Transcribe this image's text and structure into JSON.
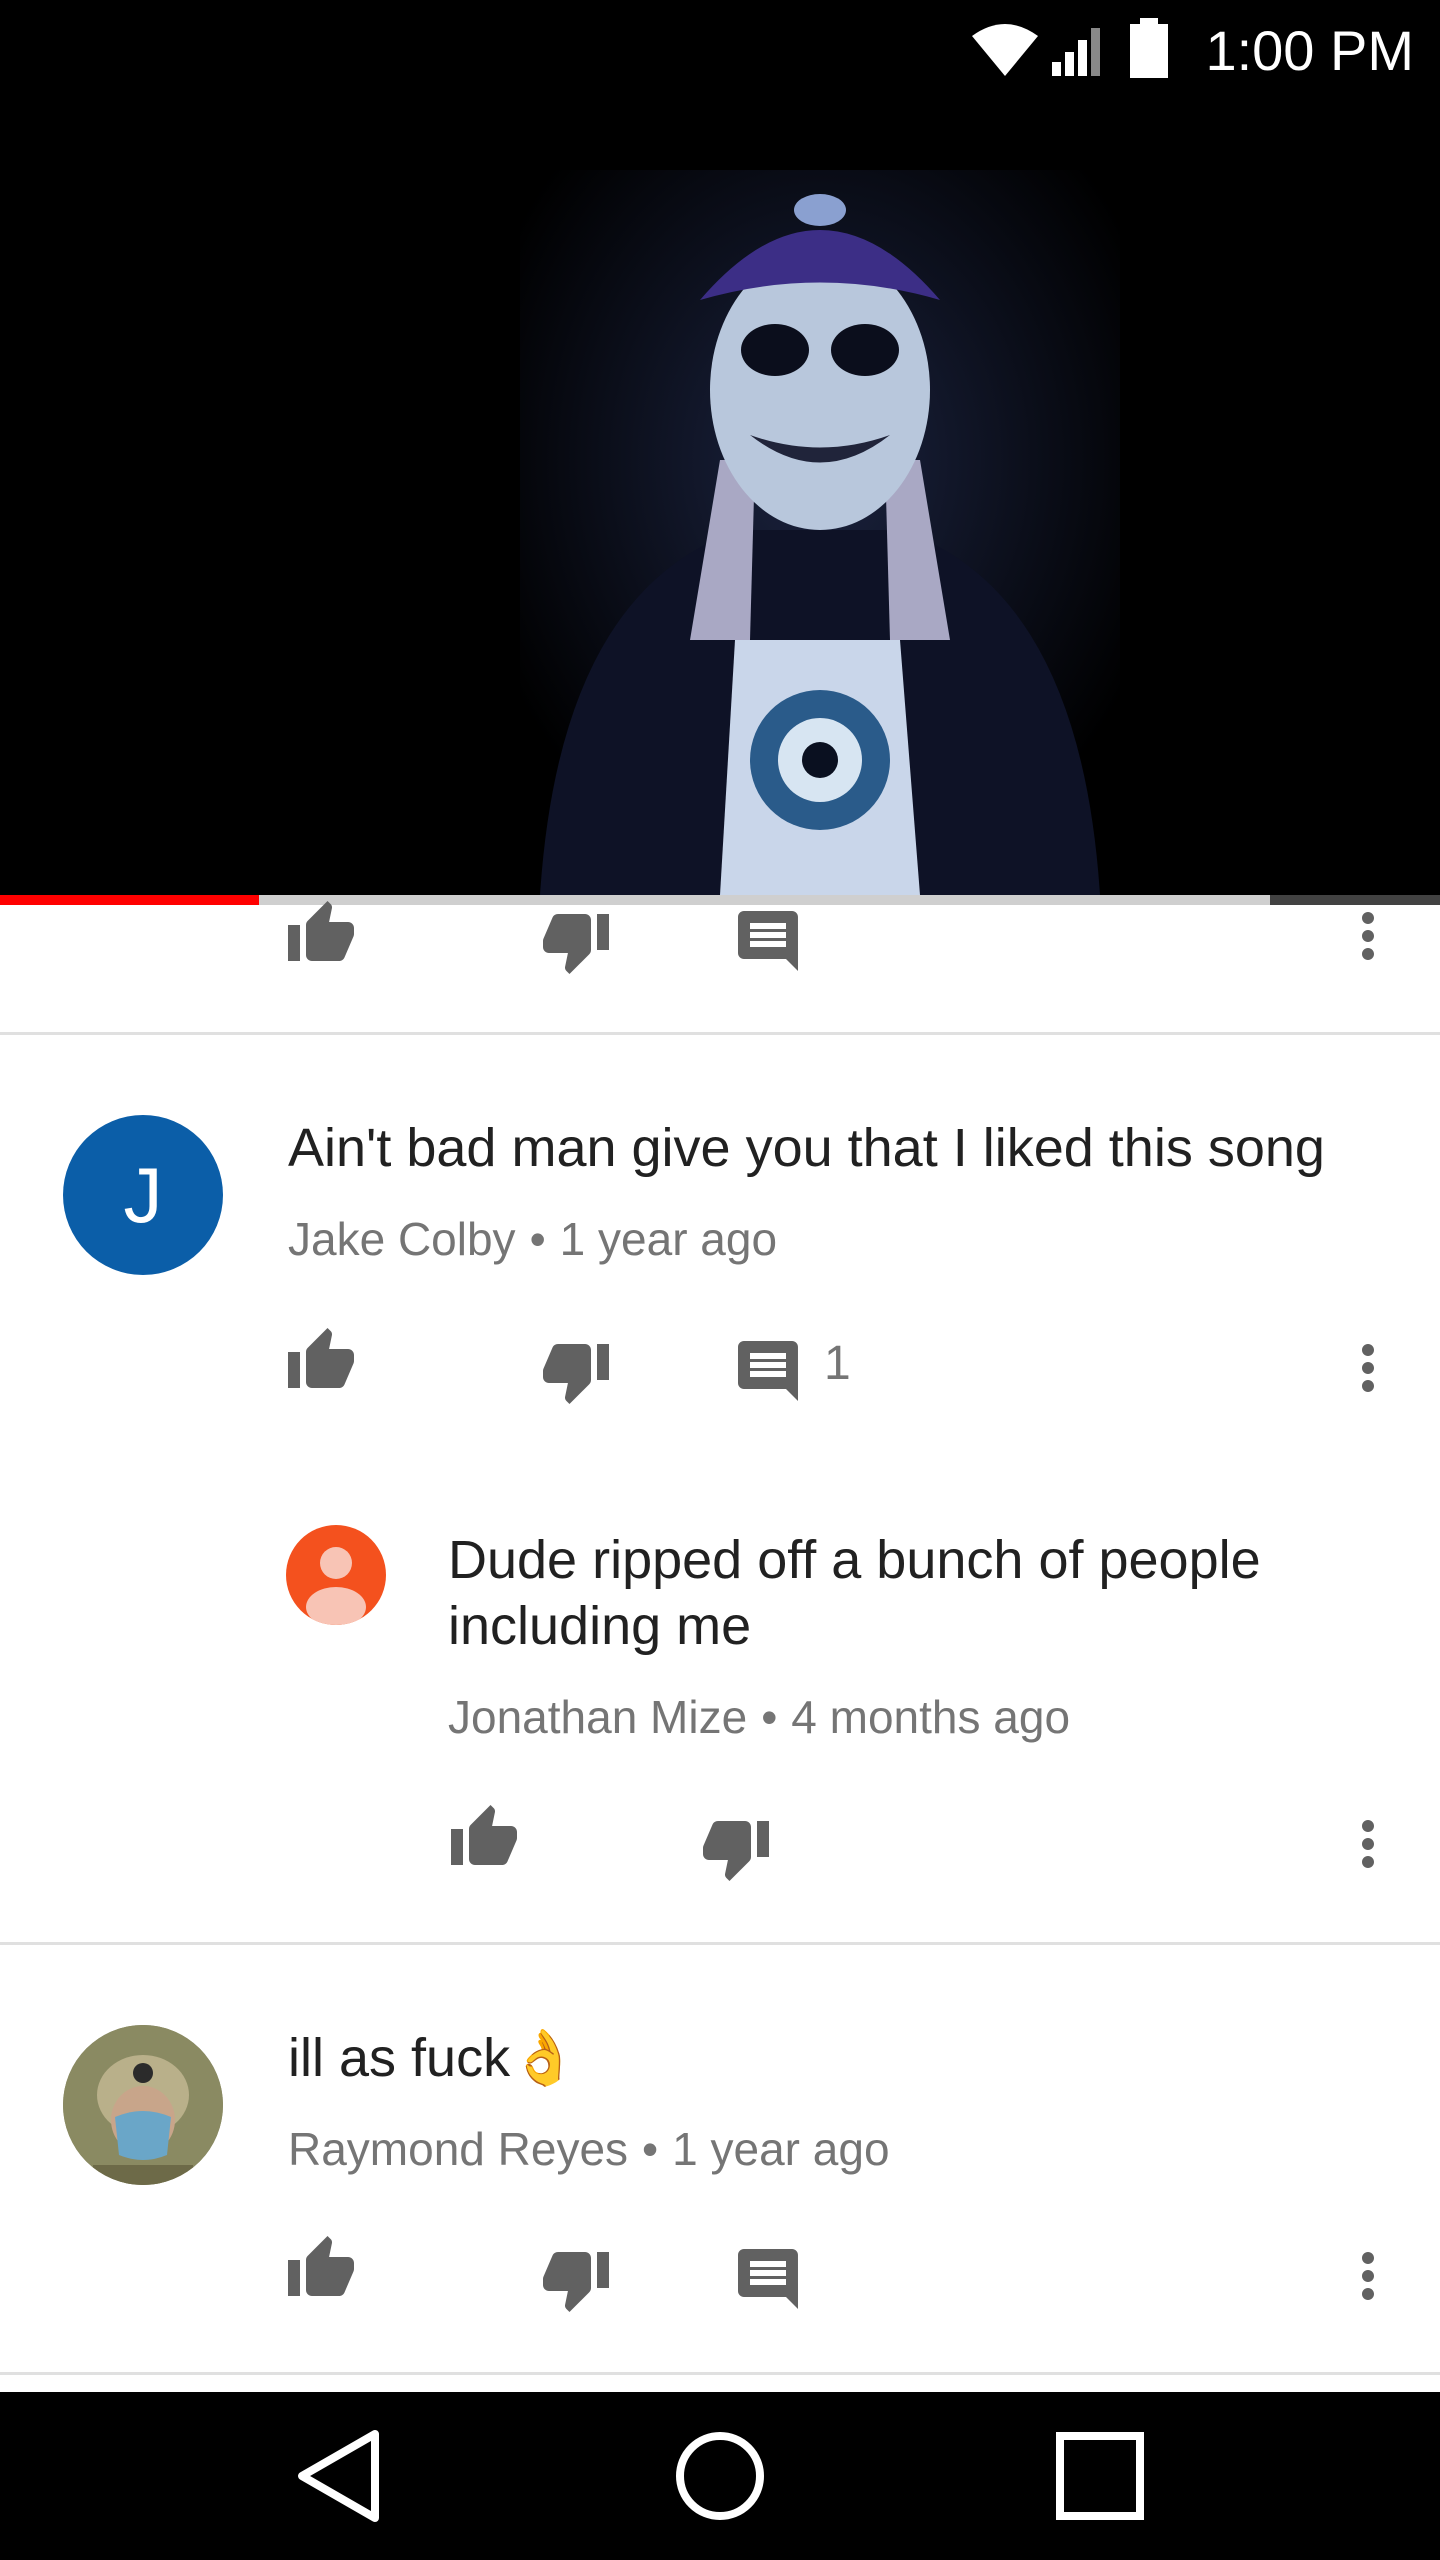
{
  "status_bar": {
    "time": "1:00 PM"
  },
  "video": {
    "progress": 0.18,
    "buffered_from": 0.88
  },
  "top_actions": {
    "icons": [
      "thumb-up-icon",
      "thumb-down-icon",
      "reply-icon",
      "more-vert-icon"
    ]
  },
  "comments": [
    {
      "avatar_letter": "J",
      "text": "Ain't bad man give you that I liked this song",
      "author": "Jake Colby",
      "time": "1 year ago",
      "reply_count": "1"
    },
    {
      "text": "Dude ripped off a bunch of people including me",
      "author": "Jonathan Mize",
      "time": "4 months ago"
    },
    {
      "text": "ill as fuck",
      "emoji": "👌",
      "author": "Raymond Reyes",
      "time": "1 year ago"
    }
  ],
  "separator": "•",
  "colors": {
    "progress_played": "#ff0000",
    "avatar_j": "#0b5ea8",
    "avatar_default": "#f4511e"
  }
}
